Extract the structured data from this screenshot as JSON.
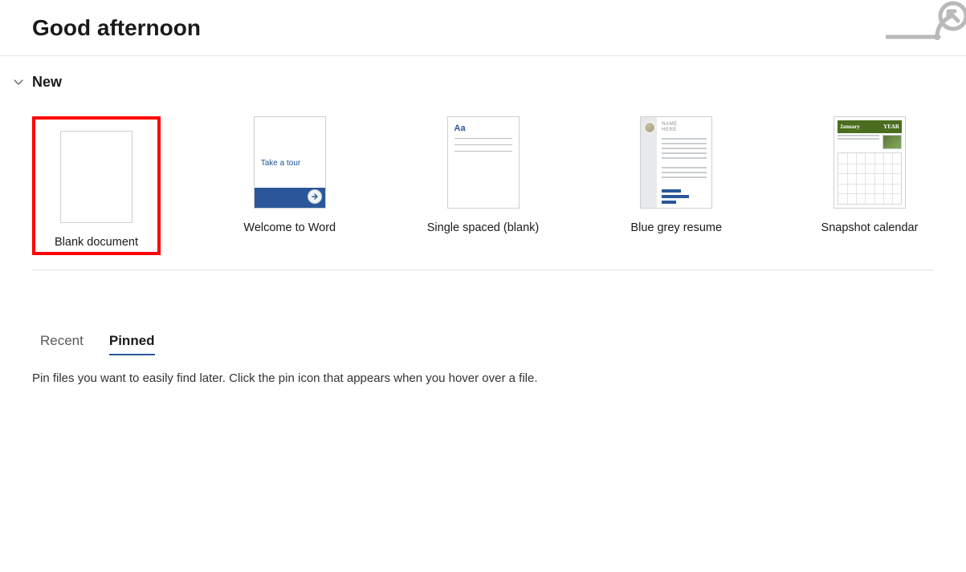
{
  "header": {
    "greeting": "Good afternoon"
  },
  "new_section": {
    "title": "New",
    "templates": [
      {
        "label": "Blank document",
        "highlighted": true
      },
      {
        "label": "Welcome to Word",
        "tour_text": "Take a tour"
      },
      {
        "label": "Single spaced (blank)",
        "sample": "Aa"
      },
      {
        "label": "Blue grey resume",
        "name_text": "NAME\nHERE"
      },
      {
        "label": "Snapshot calendar",
        "month": "January",
        "year": "YEAR"
      }
    ]
  },
  "lists": {
    "tabs": [
      {
        "label": "Recent",
        "active": false
      },
      {
        "label": "Pinned",
        "active": true
      }
    ],
    "hint": "Pin files you want to easily find later. Click the pin icon that appears when you hover over a file."
  }
}
